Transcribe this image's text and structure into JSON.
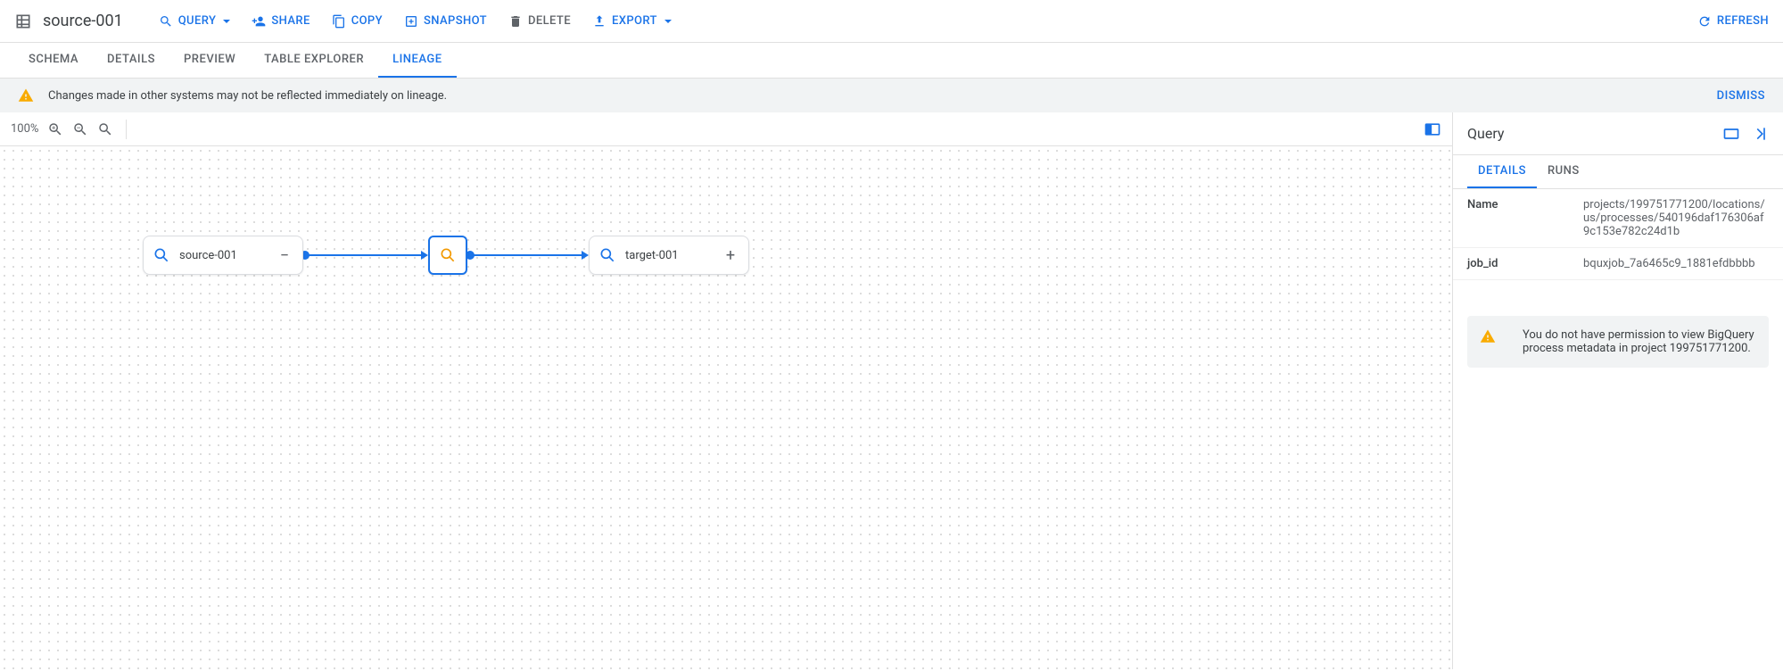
{
  "header": {
    "title": "source-001",
    "actions": {
      "query": "QUERY",
      "share": "SHARE",
      "copy": "COPY",
      "snapshot": "SNAPSHOT",
      "delete": "DELETE",
      "export": "EXPORT",
      "refresh": "REFRESH"
    }
  },
  "tabs": {
    "schema": "SCHEMA",
    "details": "DETAILS",
    "preview": "PREVIEW",
    "table_explorer": "TABLE EXPLORER",
    "lineage": "LINEAGE"
  },
  "banner": {
    "text": "Changes made in other systems may not be reflected immediately on lineage.",
    "dismiss": "DISMISS"
  },
  "canvas": {
    "zoom": "100%",
    "nodes": {
      "source": "source-001",
      "target": "target-001"
    }
  },
  "side": {
    "title": "Query",
    "tabs": {
      "details": "DETAILS",
      "runs": "RUNS"
    },
    "props": {
      "name_key": "Name",
      "name_val": "projects/199751771200/locations/us/processes/540196daf176306af9c153e782c24d1b",
      "jobid_key": "job_id",
      "jobid_val": "bquxjob_7a6465c9_1881efdbbbb"
    },
    "warning": "You do not have permission to view BigQuery process metadata in project 199751771200."
  }
}
